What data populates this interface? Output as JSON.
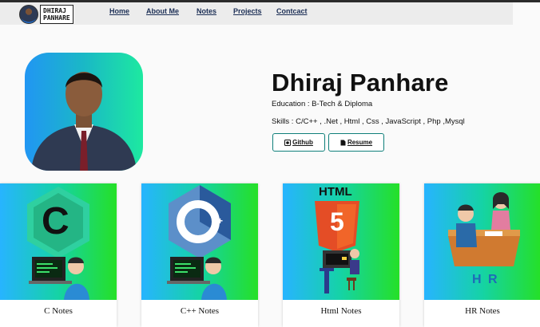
{
  "header": {
    "logo_text_line1": "DHIRAJ",
    "logo_text_line2": "PANHARE",
    "nav": [
      {
        "label": "Home"
      },
      {
        "label": "About Me"
      },
      {
        "label": "Notes"
      },
      {
        "label": "Projects"
      },
      {
        "label": "Contcact"
      }
    ]
  },
  "profile": {
    "name": "Dhiraj Panhare",
    "education": "Education : B-Tech & Diploma",
    "skills": "Skills : C/C++ , .Net , Html , Css , JavaScript , Php ,Mysql",
    "github_label": "Github",
    "resume_label": "Resume"
  },
  "cards": [
    {
      "label": "C Notes",
      "art_text": "C"
    },
    {
      "label": "C++ Notes",
      "art_text": "C",
      "art_sup": "++"
    },
    {
      "label": "Html Notes",
      "art_text": "HTML",
      "art_num": "5"
    },
    {
      "label": "HR Notes",
      "art_text": "H R"
    }
  ],
  "icons": {
    "github": "github-icon",
    "resume": "document-icon"
  },
  "colors": {
    "accent": "#0f7f7a",
    "nav_text": "#1b2e55",
    "card_gradient_start": "#27b4ff",
    "card_gradient_end": "#25e027"
  }
}
